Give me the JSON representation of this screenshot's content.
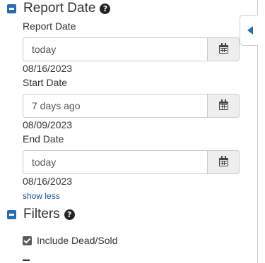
{
  "report_date_section": {
    "title": "Report Date",
    "help_icon": "question-circle-icon",
    "collapse_icon": "minus-square-icon"
  },
  "fields": {
    "report_date": {
      "label": "Report Date",
      "value": "today",
      "resolved": "08/16/2023",
      "addon_icon": "calendar-icon"
    },
    "start_date": {
      "label": "Start Date",
      "value": "7 days ago",
      "resolved": "08/09/2023",
      "addon_icon": "calendar-icon"
    },
    "end_date": {
      "label": "End Date",
      "value": "today",
      "resolved": "08/16/2023",
      "addon_icon": "calendar-icon"
    }
  },
  "show_less_link": "show less",
  "filters_section": {
    "title": "Filters",
    "help_icon": "question-circle-icon",
    "collapse_icon": "minus-square-icon"
  },
  "include_dead_sold": {
    "label": "Include Dead/Sold",
    "checked": true
  },
  "sidebar_toggle_icon": "caret-left-icon",
  "colors": {
    "accent": "#2a6cb0",
    "link": "#1a4f9c",
    "addon_bg": "#eeeeee",
    "border": "#cccccc"
  }
}
